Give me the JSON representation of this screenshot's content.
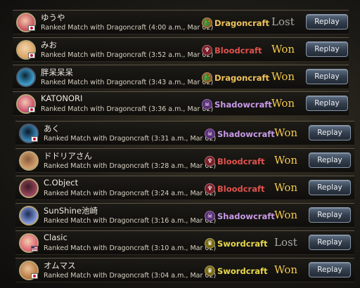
{
  "colors": {
    "won": "#f2c94c",
    "lost": "#a9aaa6",
    "Dragoncraft": "#f0c45c",
    "Bloodcraft": "#e0524e",
    "Shadowcraft": "#c89ae8",
    "Swordcraft": "#e8d84c"
  },
  "button_label": "Replay",
  "matches": [
    {
      "player": "ゆうや",
      "detail": "Ranked Match with Dragoncraft (4:00 a.m., Mar 02)",
      "craft": "Dragoncraft",
      "result": "Lost",
      "flag": "jp",
      "avatar_icon": "avatar-icon"
    },
    {
      "player": "みお",
      "detail": "Ranked Match with Dragoncraft (3:52 a.m., Mar 02)",
      "craft": "Bloodcraft",
      "result": "Won",
      "flag": "jp",
      "avatar_icon": "avatar-icon"
    },
    {
      "player": "胖呆呆呆",
      "detail": "Ranked Match with Dragoncraft (3:43 a.m., Mar 02)",
      "craft": "Dragoncraft",
      "result": "Won",
      "flag": "",
      "avatar_icon": "emblem-icon"
    },
    {
      "player": "KATONORI",
      "detail": "Ranked Match with Dragoncraft (3:36 a.m., Mar 02)",
      "craft": "Shadowcraft",
      "result": "Won",
      "flag": "jp",
      "avatar_icon": "avatar-icon"
    },
    {
      "player": "あく",
      "detail": "Ranked Match with Dragoncraft (3:31 a.m., Mar 02)",
      "craft": "Shadowcraft",
      "result": "Won",
      "flag": "jp",
      "avatar_icon": "emblem-icon"
    },
    {
      "player": "ドドリアさん",
      "detail": "Ranked Match with Dragoncraft (3:28 a.m., Mar 02)",
      "craft": "Bloodcraft",
      "result": "Won",
      "flag": "",
      "avatar_icon": "avatar-icon"
    },
    {
      "player": "C.Object",
      "detail": "Ranked Match with Dragoncraft (3:24 a.m., Mar 02)",
      "craft": "Bloodcraft",
      "result": "Won",
      "flag": "",
      "avatar_icon": "avatar-icon"
    },
    {
      "player": "SunShine池崎",
      "detail": "Ranked Match with Dragoncraft (3:16 a.m., Mar 02)",
      "craft": "Shadowcraft",
      "result": "Won",
      "flag": "",
      "avatar_icon": "avatar-icon"
    },
    {
      "player": "Clasic",
      "detail": "Ranked Match with Dragoncraft (3:10 a.m., Mar 02)",
      "craft": "Swordcraft",
      "result": "Lost",
      "flag": "us",
      "avatar_icon": "avatar-icon"
    },
    {
      "player": "オムマス",
      "detail": "Ranked Match with Dragoncraft (3:04 a.m., Mar 02)",
      "craft": "Swordcraft",
      "result": "Won",
      "flag": "jp",
      "avatar_icon": "avatar-icon"
    }
  ]
}
